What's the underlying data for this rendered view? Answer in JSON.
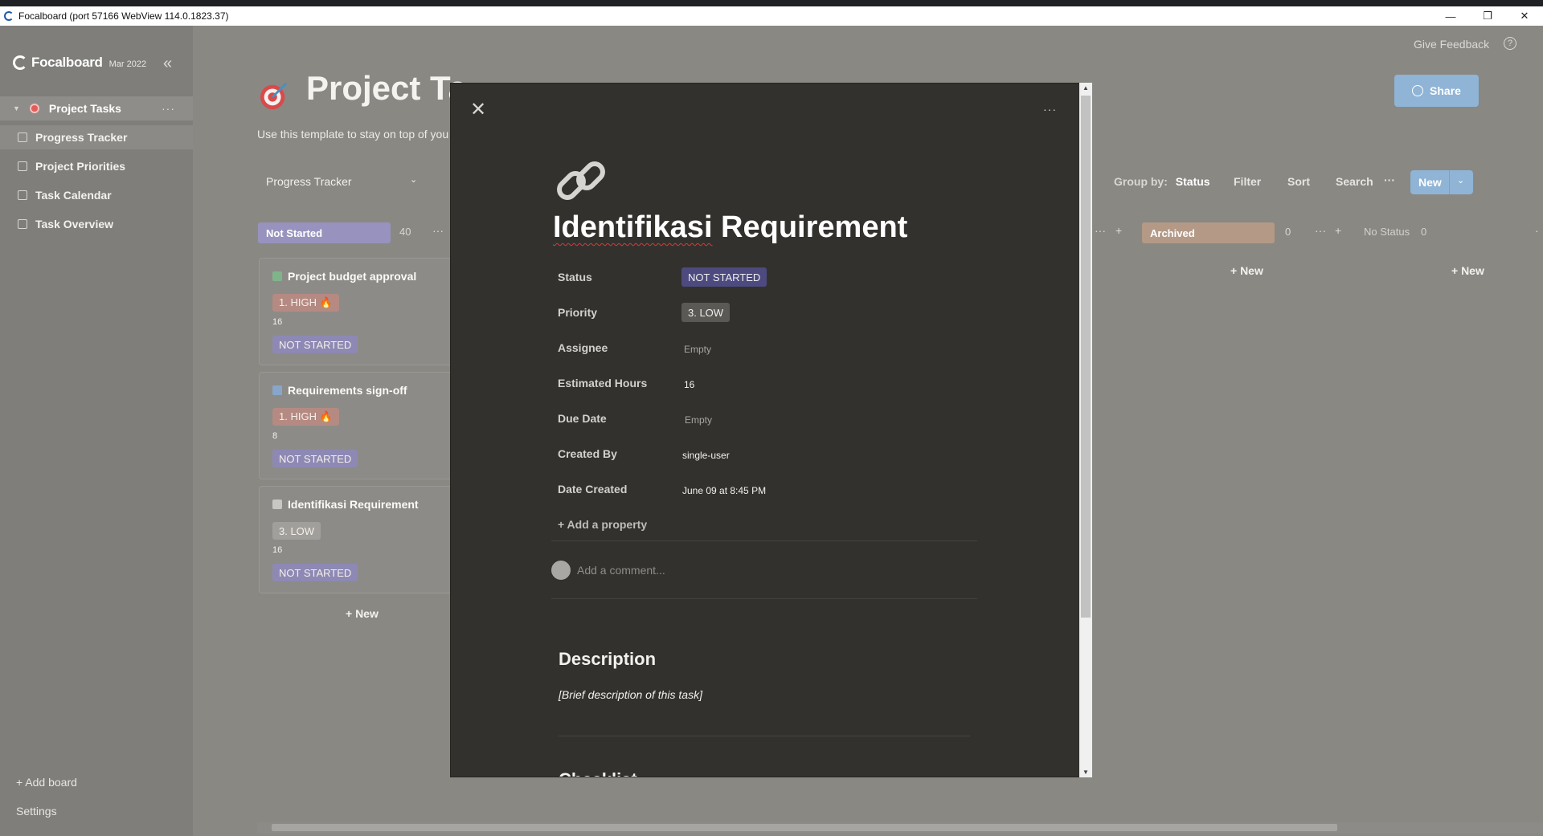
{
  "window": {
    "title": "Focalboard (port 57166 WebView 114.0.1823.37)",
    "minimize": "—",
    "maximize": "❐",
    "close": "✕"
  },
  "sidebar": {
    "logo": "Focalboard",
    "version": "Mar 2022",
    "collapse_icon": "«",
    "board": {
      "label": "Project Tasks",
      "menu": "···"
    },
    "views": [
      {
        "label": "Progress Tracker"
      },
      {
        "label": "Project Priorities"
      },
      {
        "label": "Task Calendar"
      },
      {
        "label": "Task Overview"
      }
    ],
    "add_board": "+ Add board",
    "settings": "Settings"
  },
  "header": {
    "give_feedback": "Give Feedback",
    "help": "?",
    "title": "Project Ta",
    "description": "Use this template to stay on top of you",
    "share": "Share"
  },
  "toolbar": {
    "view_name": "Progress Tracker",
    "group_by_label": "Group by:",
    "group_by_value": "Status",
    "filter": "Filter",
    "sort": "Sort",
    "search": "Search",
    "more": "···",
    "new": "New",
    "dropdown": "⌄"
  },
  "columns": [
    {
      "label": "Not Started",
      "count": "40",
      "color": "#9793be"
    },
    {
      "label": "Archived",
      "count": "0",
      "color": "#b49a86"
    },
    {
      "label": "No Status",
      "count": "0"
    }
  ],
  "column_actions": {
    "more": "···",
    "add": "+",
    "new": "+ New"
  },
  "cards": [
    {
      "title": "Project budget approval",
      "priority": "1. HIGH 🔥",
      "hours": "16",
      "status": "NOT STARTED",
      "icon_color": "#7fb48a"
    },
    {
      "title": "Requirements sign-off",
      "priority": "1. HIGH 🔥",
      "hours": "8",
      "status": "NOT STARTED",
      "icon_color": "#88a6c9"
    },
    {
      "title": "Identifikasi Requirement",
      "priority": "3. LOW",
      "hours": "16",
      "status": "NOT STARTED",
      "icon_color": "#c9c7c3"
    }
  ],
  "dialog": {
    "close": "✕",
    "more": "···",
    "title_part1": "Identifikasi",
    "title_part2": " Requirement",
    "properties": [
      {
        "name": "Status",
        "value": "NOT STARTED",
        "kind": "pill-ns"
      },
      {
        "name": "Priority",
        "value": "3. LOW",
        "kind": "pill-low"
      },
      {
        "name": "Assignee",
        "value": "Empty",
        "kind": "empty"
      },
      {
        "name": "Estimated Hours",
        "value": "16",
        "kind": "text"
      },
      {
        "name": "Due Date",
        "value": "Empty",
        "kind": "empty"
      },
      {
        "name": "Created By",
        "value": "single-user",
        "kind": "text"
      },
      {
        "name": "Date Created",
        "value": "June 09 at 8:45 PM",
        "kind": "text"
      }
    ],
    "add_property": "+ Add a property",
    "comment_placeholder": "Add a comment...",
    "description_heading": "Description",
    "description_text": "[Brief description of this task]",
    "checklist_heading": "Checklist"
  }
}
